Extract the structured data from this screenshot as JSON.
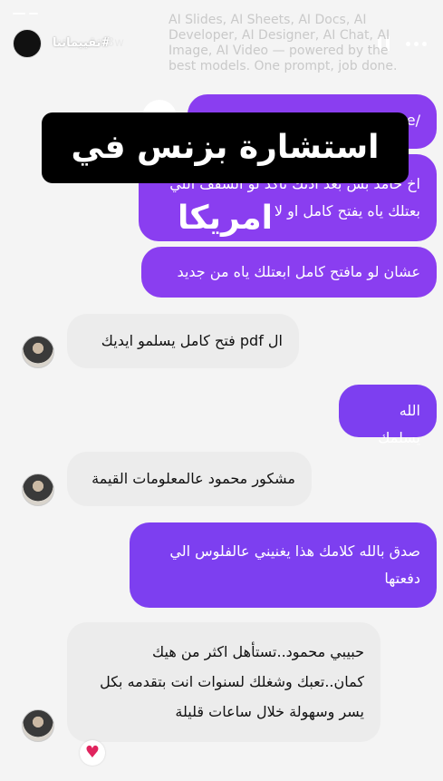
{
  "header": {
    "username": "تقييماتنا#",
    "time": "8w"
  },
  "overlay_ad": "AI Slides, AI Sheets, AI Docs, AI Developer, AI Designer, AI Chat, AI Image, AI Video — powered by the best models. One prompt, job done.",
  "title": "استشارة بزنس في امريكا",
  "messages": [
    {
      "side": "right",
      "text": "/ne"
    },
    {
      "side": "right",
      "text": "اخ حامد بس بعد اذنك تاكد لو السقف اللي بعتلك ياه يفتح كامل او لا"
    },
    {
      "side": "right",
      "text": "عشان لو مافتح كامل ابعتلك ياه من جديد"
    },
    {
      "side": "left",
      "text": "ال pdf فتح كامل يسلمو ايديك"
    },
    {
      "side": "right",
      "text": "الله يسلمك"
    },
    {
      "side": "left",
      "text": "مشكور محمود عالمعلومات القيمة"
    },
    {
      "side": "right",
      "text": "صدق بالله كلامك هذا يغنيني عالفلوس الي دفعتها"
    },
    {
      "side": "left",
      "text": "حبيبي محمود..تستأهل اكثر من هيك كمان..تعبك وشغلك لسنوات انت بتقدمه بكل يسر وسهولة خلال ساعات قليلة"
    }
  ],
  "reaction": "♥"
}
